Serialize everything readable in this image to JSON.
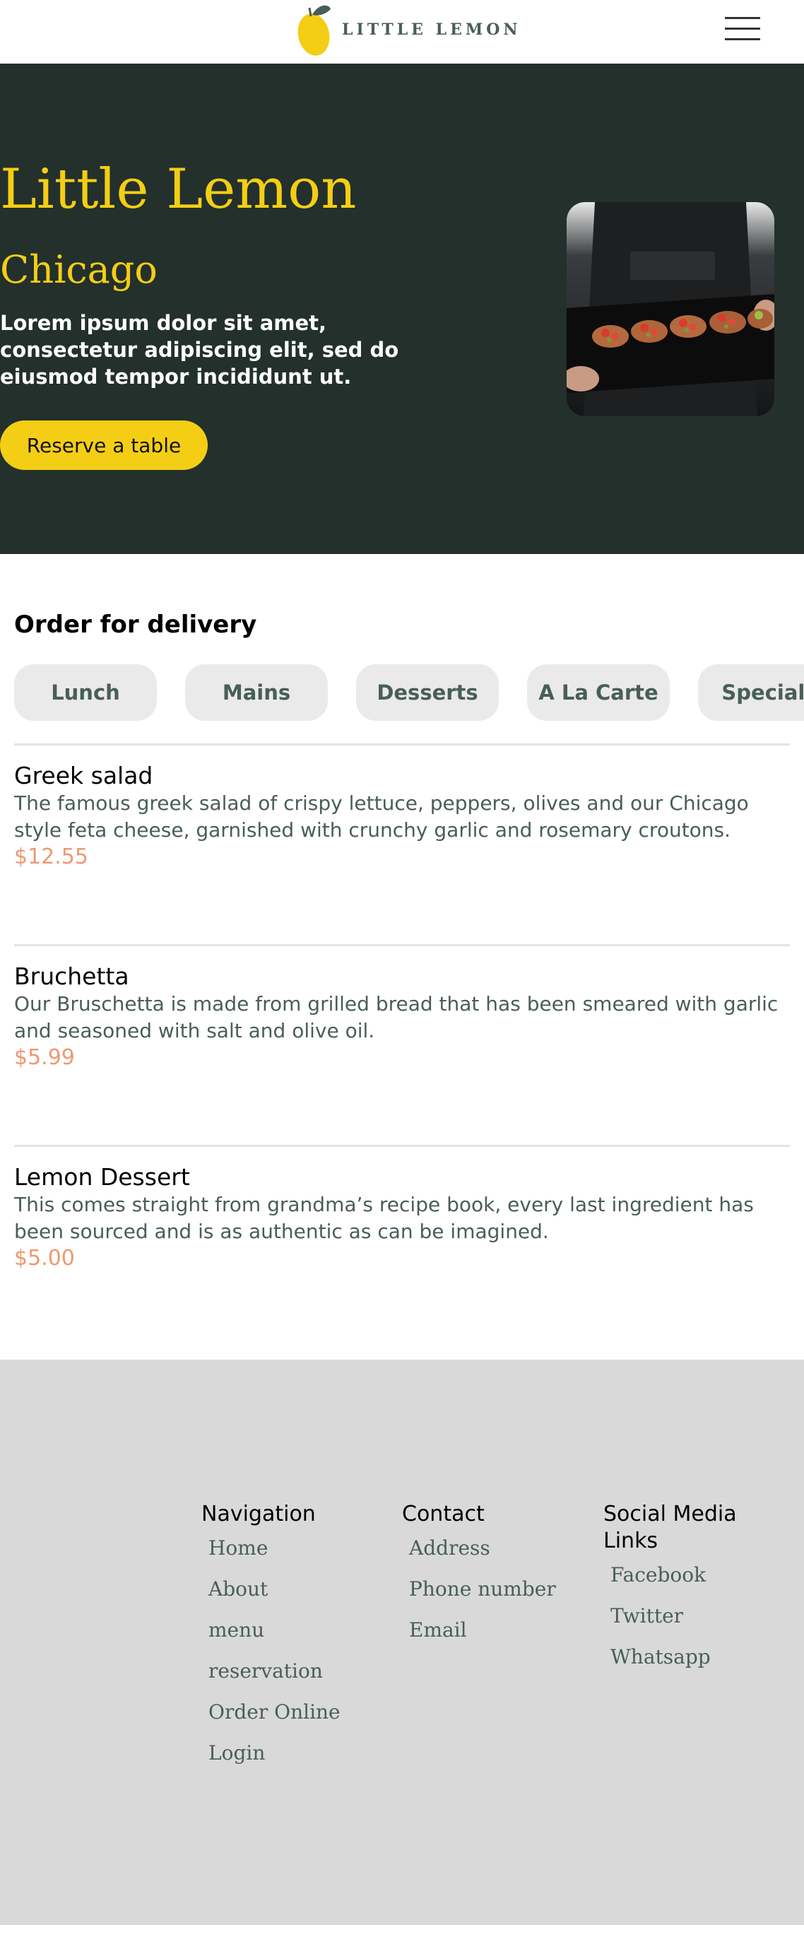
{
  "header": {
    "logo_text": "LITTLE LEMON",
    "logo_icon": "lemon-icon",
    "menu_icon": "hamburger-icon"
  },
  "hero": {
    "title": "Little Lemon",
    "subtitle": "Chicago",
    "description": "Lorem ipsum dolor sit amet, consectetur adipiscing elit, sed do eiusmod tempor incididunt ut.",
    "cta_label": "Reserve a table",
    "image_icon": "food-platter-image"
  },
  "delivery": {
    "title": "Order for delivery",
    "tabs": [
      "Lunch",
      "Mains",
      "Desserts",
      "A La Carte",
      "Specials"
    ],
    "items": [
      {
        "name": "Greek salad",
        "description": "The famous greek salad of crispy lettuce, peppers, olives and our Chicago style feta cheese, garnished with crunchy garlic and rosemary croutons.",
        "price": "$12.55"
      },
      {
        "name": "Bruchetta",
        "description": "Our Bruschetta is made from grilled bread that has been smeared with garlic and seasoned with salt and olive oil.",
        "price": "$5.99"
      },
      {
        "name": "Lemon Dessert",
        "description": "This comes straight from grandma’s recipe book, every last ingredient has been sourced and is as authentic as can be imagined.",
        "price": "$5.00"
      }
    ]
  },
  "footer": {
    "navigation": {
      "title": "Navigation",
      "links": [
        "Home",
        "About",
        "menu",
        "reservation",
        "Order Online",
        "Login"
      ]
    },
    "contact": {
      "title": "Contact",
      "links": [
        "Address",
        "Phone number",
        "Email"
      ]
    },
    "social": {
      "title": "Social Media Links",
      "links": [
        "Facebook",
        "Twitter",
        "Whatsapp"
      ]
    }
  },
  "colors": {
    "primary_green": "#495e57",
    "hero_bg": "#23302c",
    "primary_yellow": "#f4ce14",
    "price_salmon": "#ee9972",
    "footer_bg": "#d9d9d9"
  }
}
